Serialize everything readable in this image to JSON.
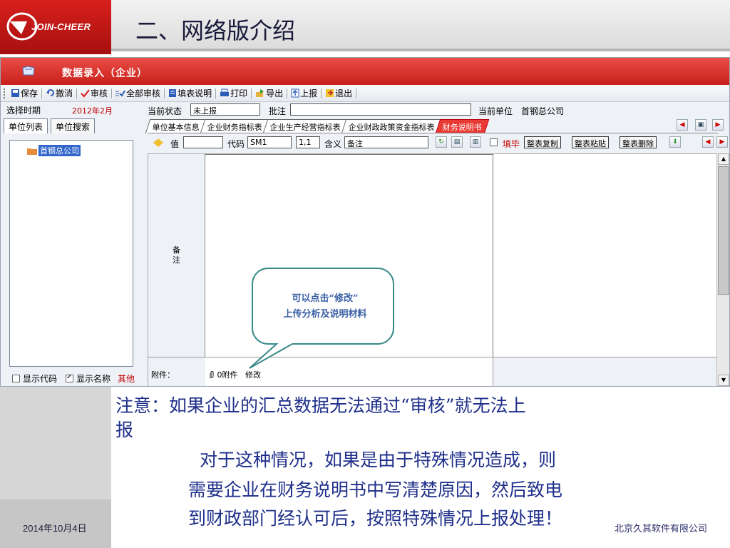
{
  "slide": {
    "logo_text": "JOIN-CHEER",
    "title": "二、网络版介绍",
    "date": "2014年10月4日",
    "footer": "北京久其软件有限公司"
  },
  "app": {
    "title": "数据录入（企业）",
    "toolbar": [
      "保存",
      "撤消",
      "审核",
      "全部审核",
      "填表说明",
      "打印",
      "导出",
      "上报",
      "退出"
    ],
    "left": {
      "period_label": "选择时期",
      "period_value": "2012年2月",
      "tabs": [
        "单位列表",
        "单位搜索"
      ],
      "tree_node": "首钢总公司",
      "show_code": "显示代码",
      "show_name": "显示名称",
      "other": "其他"
    },
    "status": {
      "state_label": "当前状态",
      "state_value": "未上报",
      "comment_label": "批注",
      "comment_value": "",
      "unit_label": "当前单位",
      "unit_value": "首钢总公司"
    },
    "tabs": [
      "单位基本信息",
      "企业财务指标表",
      "企业生产经营指标表",
      "企业财政政策资金指标表",
      "财务说明书"
    ],
    "row2": {
      "value_label": "值",
      "value_value": "",
      "code_label": "代码",
      "code_value": "SM1",
      "pos_value": "1,1",
      "meaning_label": "含义",
      "meaning_value": "备注",
      "done_label": "填毕",
      "btn_copy": "整表复制",
      "btn_paste": "整表粘贴",
      "btn_delete": "整表删除"
    },
    "content": {
      "remark_label": "备注",
      "attach_label": "附件：",
      "attach_count": "0附件",
      "attach_edit": "修改"
    }
  },
  "callout": {
    "line1": "可以点击“修改”",
    "line2": "上传分析及说明材料"
  },
  "notes": {
    "line1": "注意：如果企业的汇总数据无法通过“审核”就无法上",
    "line2": "报",
    "line3": "对于这种情况，如果是由于特殊情况造成，则",
    "line4": "需要企业在财务说明书中写清楚原因，然后致电",
    "line5": "到财政部门经认可后，按照特殊情况上报处理！"
  },
  "colors": {
    "brand_red": "#c8201a",
    "note_blue": "#1f2f8a",
    "callout_border": "#3a8a8a"
  }
}
